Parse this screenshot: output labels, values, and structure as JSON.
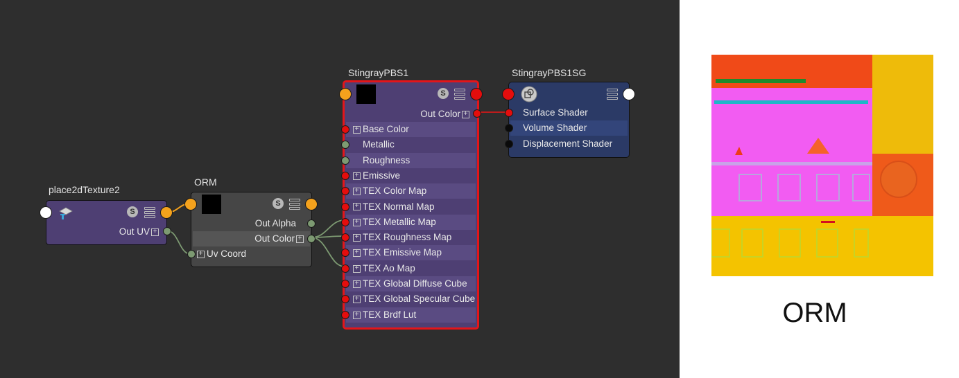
{
  "nodes": {
    "place2d": {
      "title": "place2dTexture2",
      "outputs": [
        "Out UV"
      ]
    },
    "orm": {
      "title": "ORM",
      "outputs": [
        "Out Alpha",
        "Out Color"
      ],
      "inputs": [
        "Uv Coord"
      ]
    },
    "stingray": {
      "title": "StingrayPBS1",
      "output": "Out Color",
      "attributes": [
        "Base Color",
        "Metallic",
        "Roughness",
        "Emissive",
        "TEX Color Map",
        "TEX Normal Map",
        "TEX Metallic Map",
        "TEX Roughness Map",
        "TEX Emissive Map",
        "TEX Ao Map",
        "TEX Global Diffuse Cube",
        "TEX Global Specular Cube",
        "TEX Brdf Lut"
      ]
    },
    "sg": {
      "title": "StingrayPBS1SG",
      "inputs": [
        "Surface Shader",
        "Volume Shader",
        "Displacement Shader"
      ]
    }
  },
  "preview": {
    "caption": "ORM"
  },
  "colors": {
    "editor_bg": "#2e2e2e",
    "node_purple": "#4e3f73",
    "node_gray": "#464646",
    "node_blue": "#2b3a66",
    "selection": "#e3151a",
    "wire_green": "#7d9a72",
    "wire_red": "#d11a1a",
    "wire_orange": "#f4a21d"
  },
  "icons": {
    "place2d_icon": "texture-placement-icon",
    "sg_icon": "shading-group-icon",
    "swatch": "color-swatch-icon",
    "menu": "attribute-list-icon",
    "s_badge": "swatch-toggle-icon"
  }
}
